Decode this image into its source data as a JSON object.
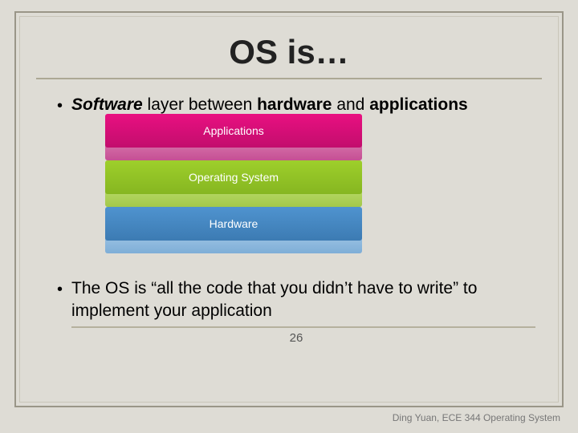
{
  "slide": {
    "title": "OS is…",
    "bullet1_prefix": "Software",
    "bullet1_mid": " layer between ",
    "bullet1_hw": "hardware",
    "bullet1_and": " and ",
    "bullet1_apps": "applications",
    "layers": {
      "top": "Applications",
      "mid": "Operating System",
      "bot": "Hardware"
    },
    "bullet2": "The OS is “all the code that you didn’t have to write” to implement your application",
    "page_number": "26",
    "footer": "Ding Yuan, ECE 344 Operating System"
  }
}
